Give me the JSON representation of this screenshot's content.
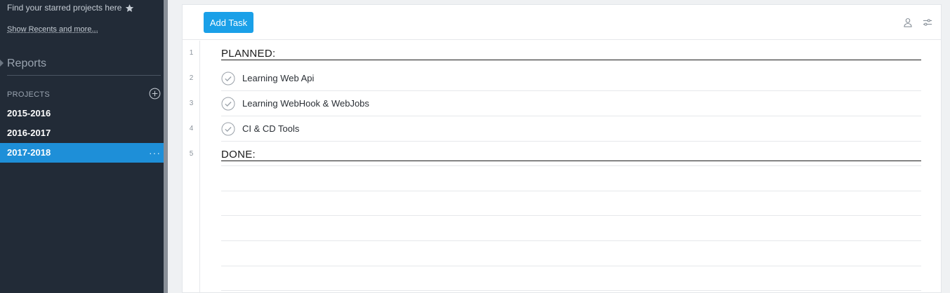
{
  "sidebar": {
    "starred_text": "Find your starred projects here",
    "show_recents": "Show Recents and more...",
    "reports": "Reports",
    "projects_header": "PROJECTS",
    "projects": [
      {
        "label": "2015-2016",
        "active": false
      },
      {
        "label": "2016-2017",
        "active": false
      },
      {
        "label": "2017-2018",
        "active": true
      }
    ],
    "more_label": "···"
  },
  "toolbar": {
    "add_task_label": "Add Task",
    "icons": [
      "person-icon",
      "filter-sliders-icon"
    ]
  },
  "task_list": {
    "rows": [
      {
        "line": "1",
        "type": "section",
        "text": "PLANNED:"
      },
      {
        "line": "2",
        "type": "task",
        "text": "Learning Web Api"
      },
      {
        "line": "3",
        "type": "task",
        "text": "Learning WebHook & WebJobs"
      },
      {
        "line": "4",
        "type": "task",
        "text": "CI & CD Tools"
      },
      {
        "line": "5",
        "type": "section",
        "text": "DONE:"
      }
    ]
  },
  "colors": {
    "sidebar_bg": "#222b37",
    "active_project": "#1e8fd8",
    "button_blue": "#1aa0e8"
  }
}
